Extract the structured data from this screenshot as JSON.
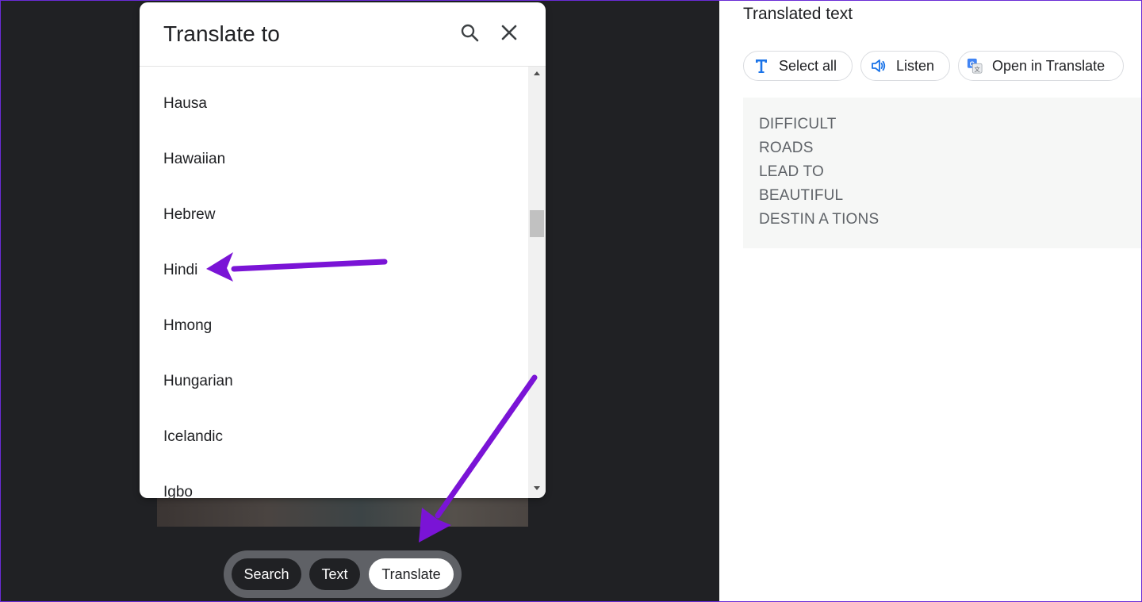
{
  "modal": {
    "title": "Translate to",
    "languages": [
      "Hausa",
      "Hawaiian",
      "Hebrew",
      "Hindi",
      "Hmong",
      "Hungarian",
      "Icelandic",
      "Igbo"
    ]
  },
  "modes": {
    "search": "Search",
    "text": "Text",
    "translate": "Translate",
    "active": "Translate"
  },
  "right": {
    "title": "Translated text",
    "select_all": "Select all",
    "listen": "Listen",
    "open_in_translate": "Open in Translate",
    "lines": [
      "DIFFICULT",
      "ROADS",
      "LEAD TO",
      "BEAUTIFUL",
      "DESTIN A TIONS"
    ]
  },
  "icons": {
    "search": "search-icon",
    "close": "close-icon",
    "text_select": "text-select-icon",
    "speaker": "speaker-icon",
    "google_translate": "google-translate-icon"
  },
  "colors": {
    "annotation": "#7a14d6",
    "accent_blue": "#1a73e8",
    "viewer_bg": "#202124"
  }
}
